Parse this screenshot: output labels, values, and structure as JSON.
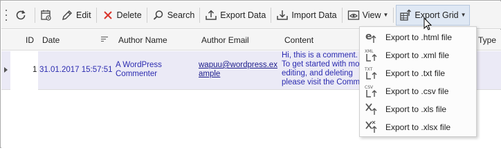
{
  "toolbar": {
    "edit": "Edit",
    "delete": "Delete",
    "search": "Search",
    "export_data": "Export Data",
    "import_data": "Import Data",
    "view": "View",
    "export_grid": "Export Grid"
  },
  "grid": {
    "columns": [
      "ID",
      "Date",
      "Author Name",
      "Author Email",
      "Content",
      "Type"
    ],
    "rows": [
      {
        "id": "1",
        "date": "31.01.2017 15:57:51",
        "author_name_1": "A WordPress",
        "author_name_2": "Commenter",
        "email_1": "wapuu@wordpress.ex",
        "email_2": "ample",
        "content_1": "Hi, this is a comment.",
        "content_2": "To get started with mo",
        "content_3": "editing, and deleting",
        "content_4": "please visit the Comme"
      }
    ]
  },
  "export_menu": {
    "items": [
      {
        "label": "Export to .html file",
        "icon": "html-file-icon"
      },
      {
        "label": "Export to .xml file",
        "icon": "xml-file-icon"
      },
      {
        "label": "Export to .txt file",
        "icon": "txt-file-icon"
      },
      {
        "label": "Export to .csv file",
        "icon": "csv-file-icon"
      },
      {
        "label": "Export to .xls file",
        "icon": "xls-file-icon"
      },
      {
        "label": "Export to .xlsx file",
        "icon": "xlsx-file-icon"
      }
    ],
    "icon_tags": {
      "xml": "XML",
      "txt": "TXT",
      "csv": "CSV"
    }
  },
  "colors": {
    "toolbar_bg": "#f4f4f4",
    "row_bg": "#ebeaf6",
    "link_text": "#2b2bb0",
    "delete_red": "#d9342b"
  }
}
